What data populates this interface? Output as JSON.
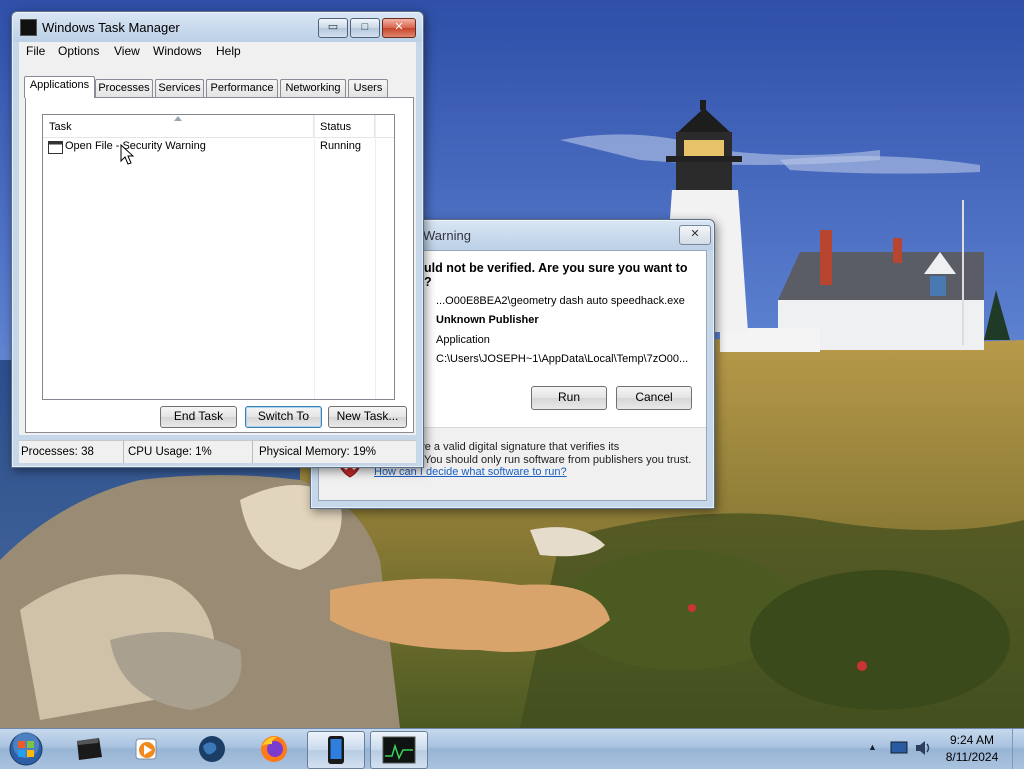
{
  "task_manager": {
    "title": "Windows Task Manager",
    "menu": [
      "File",
      "Options",
      "View",
      "Windows",
      "Help"
    ],
    "tabs": [
      "Applications",
      "Processes",
      "Services",
      "Performance",
      "Networking",
      "Users"
    ],
    "active_tab": "Applications",
    "columns": {
      "task": "Task",
      "status": "Status"
    },
    "rows": [
      {
        "task": "Open File - Security Warning",
        "status": "Running"
      }
    ],
    "buttons": {
      "end_task": "End Task",
      "switch_to": "Switch To",
      "new_task": "New Task..."
    },
    "status_bar": {
      "processes": "Processes: 38",
      "cpu": "CPU Usage: 1%",
      "memory": "Physical Memory: 19%"
    },
    "caption_buttons": {
      "minimize": "▭",
      "maximize": "□",
      "close": "✕"
    }
  },
  "security_warning": {
    "title": "Warning",
    "headline_line1": "uld not be verified.  Are you sure you want to",
    "headline_line2": "?",
    "name": "...O00E8BEA2\\geometry dash auto speedhack.exe",
    "publisher": "Unknown Publisher",
    "type": "Application",
    "from": "C:\\Users\\JOSEPH~1\\AppData\\Local\\Temp\\7zO00...",
    "buttons": {
      "run": "Run",
      "cancel": "Cancel"
    },
    "footer_line1": "es not have a valid digital signature that verifies its",
    "footer_line2": "publisher.  You should only run software from publishers you trust.",
    "footer_link": "How can I decide what software to run?",
    "close_glyph": "✕"
  },
  "taskbar": {
    "time": "9:24 AM",
    "date": "8/11/2024",
    "tray_arrow": "▲",
    "pinned": [
      "Windows Media Player",
      "Windows Media Center",
      "Firefox",
      "Phone Link",
      "Task Manager"
    ]
  },
  "colors": {
    "taskbar": "#a8c2df",
    "link": "#1a5fc2",
    "close_button": "#c4452a"
  }
}
